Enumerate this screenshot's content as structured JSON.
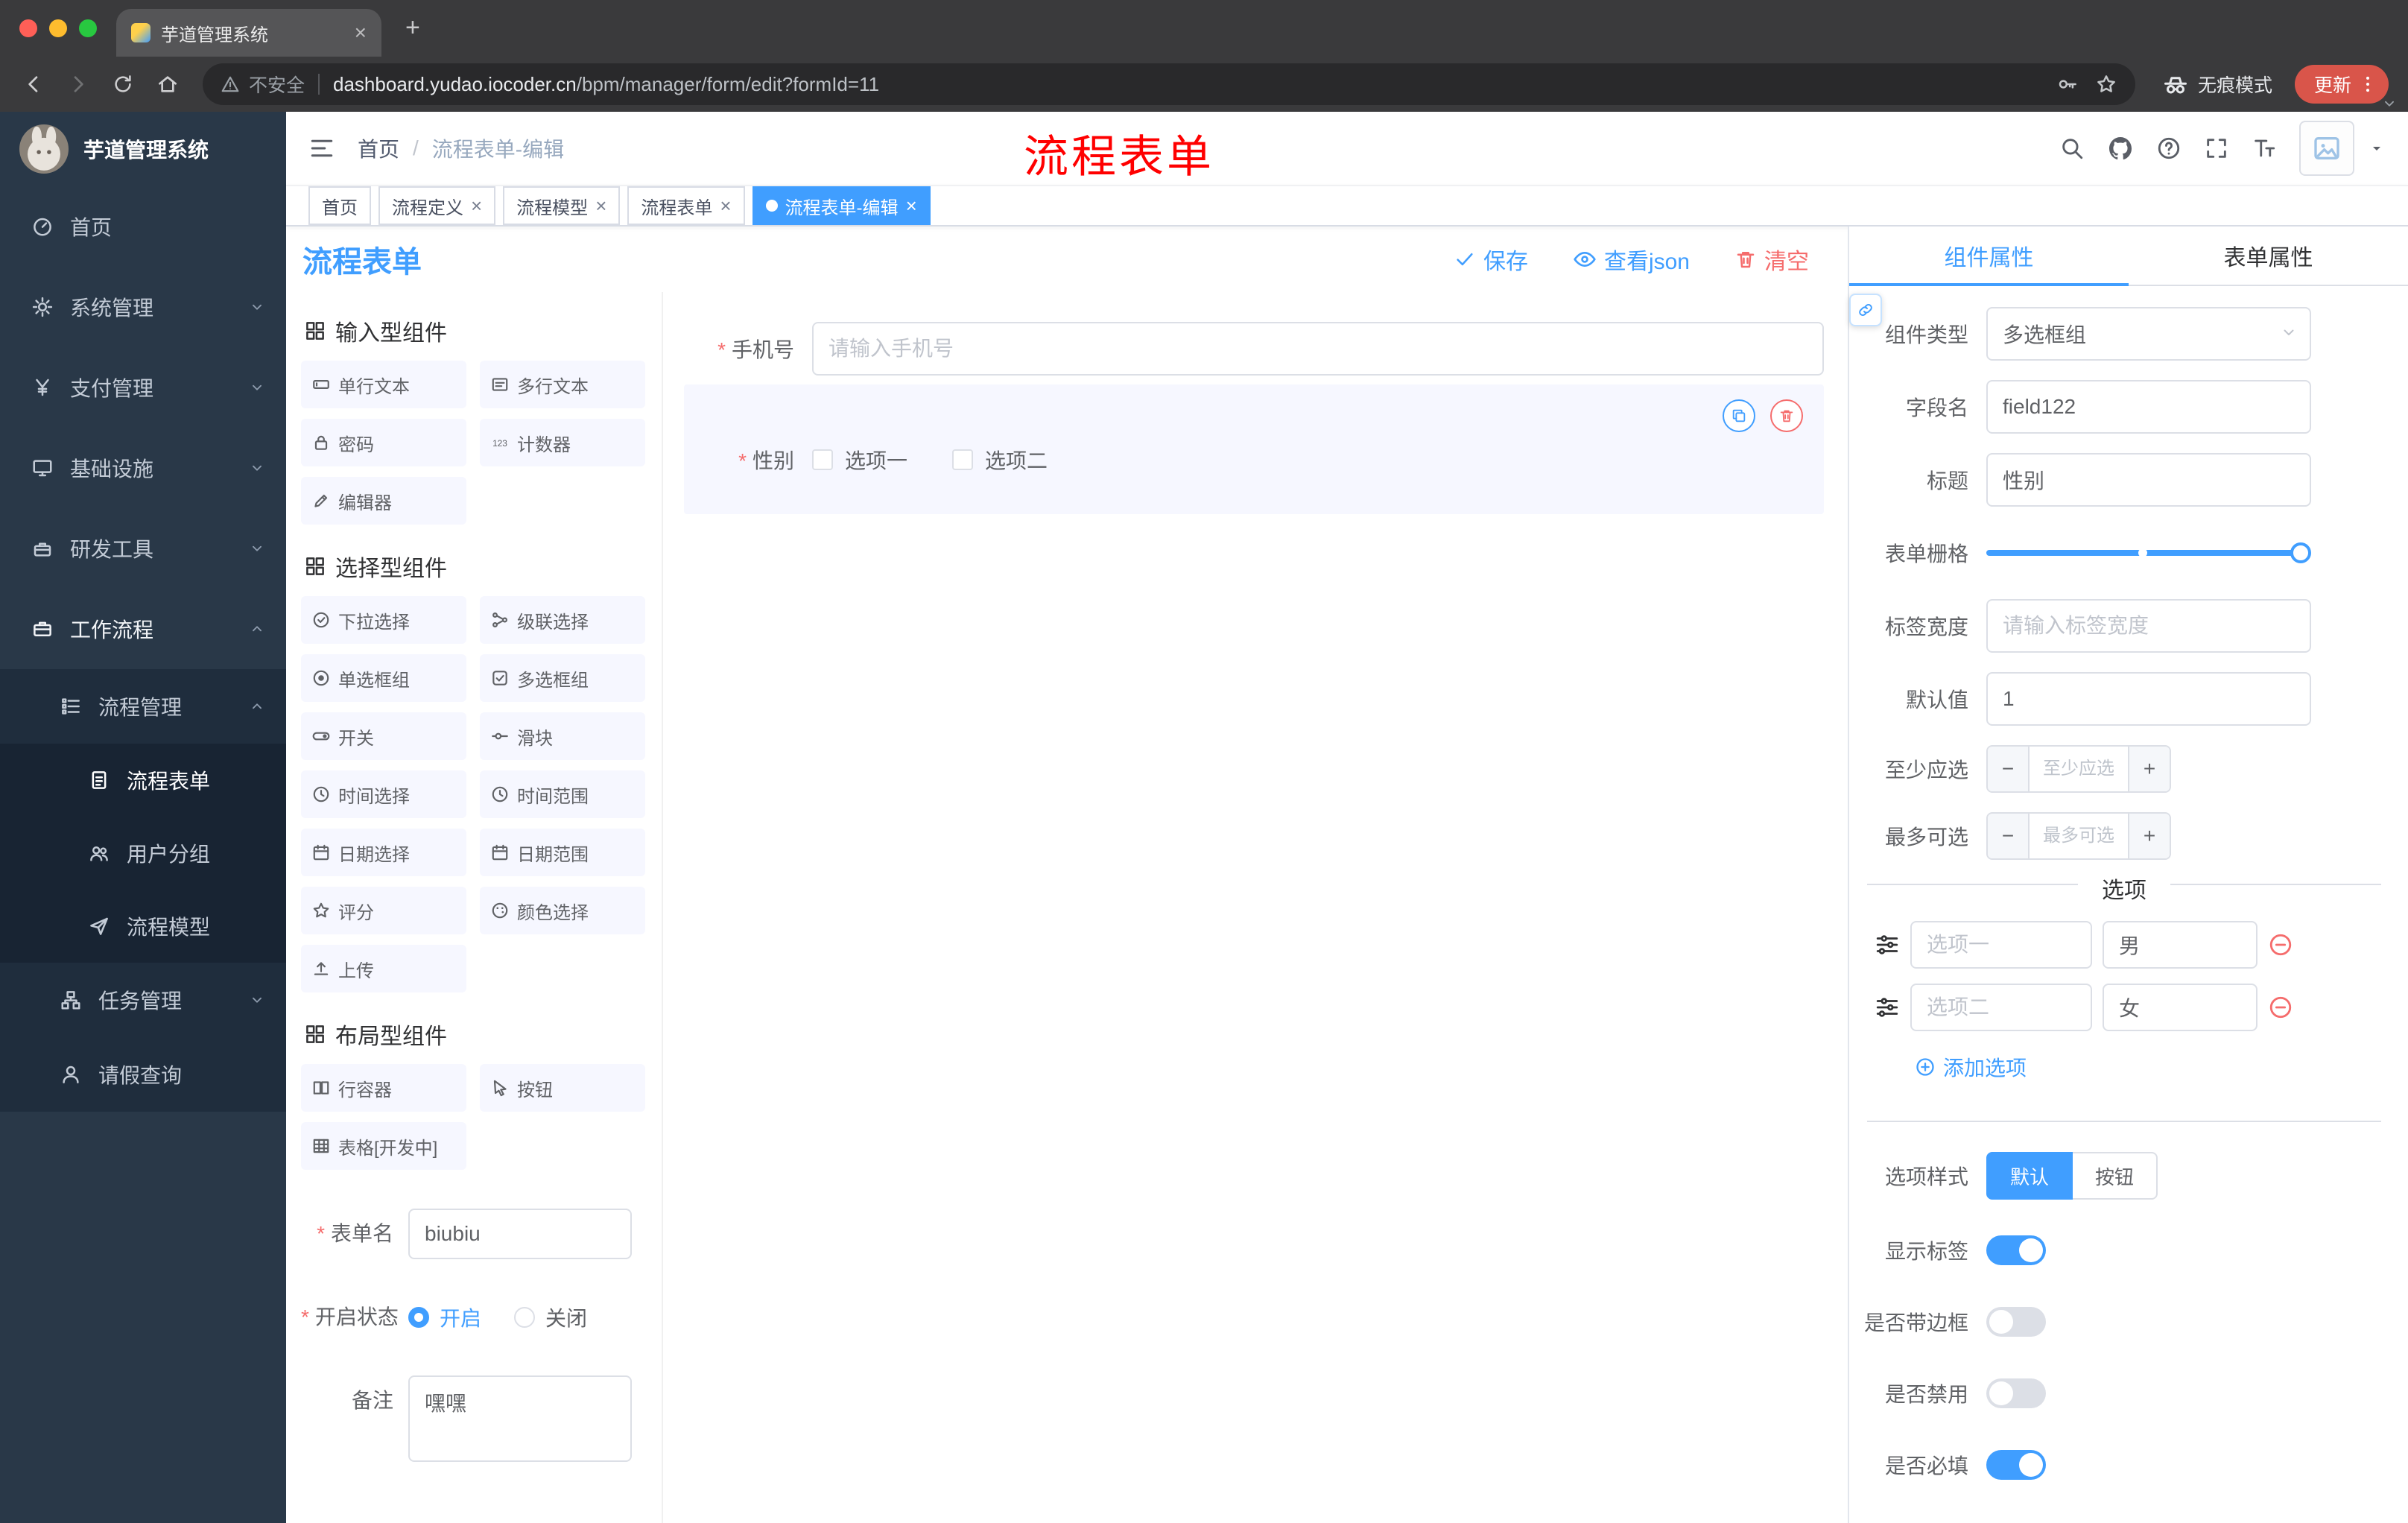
{
  "browser": {
    "tab_title": "芋道管理系统",
    "address": {
      "warning": "不安全",
      "host": "dashboard.yudao.iocoder.cn",
      "path": "/bpm/manager/form/edit?formId=11"
    },
    "incognito_label": "无痕模式",
    "update_label": "更新"
  },
  "sidebar": {
    "title": "芋道管理系统",
    "items": {
      "home": "首页",
      "system": "系统管理",
      "pay": "支付管理",
      "infra": "基础设施",
      "dev": "研发工具",
      "workflow": "工作流程",
      "process_mgmt": "流程管理",
      "process_form": "流程表单",
      "user_group": "用户分组",
      "process_model": "流程模型",
      "task_mgmt": "任务管理",
      "leave_query": "请假查询"
    }
  },
  "header": {
    "breadcrumb_home": "首页",
    "breadcrumb_current": "流程表单-编辑",
    "annotation": "流程表单"
  },
  "tags": {
    "t0": "首页",
    "t1": "流程定义",
    "t2": "流程模型",
    "t3": "流程表单",
    "t4": "流程表单-编辑"
  },
  "designer": {
    "title": "流程表单",
    "save": "保存",
    "view_json": "查看json",
    "clear": "清空",
    "group_input": "输入型组件",
    "group_select": "选择型组件",
    "group_layout": "布局型组件",
    "comp": {
      "c1": "单行文本",
      "c2": "多行文本",
      "c3": "密码",
      "c4": "计数器",
      "c5": "编辑器",
      "s1": "下拉选择",
      "s2": "级联选择",
      "s3": "单选框组",
      "s4": "多选框组",
      "s5": "开关",
      "s6": "滑块",
      "s7": "时间选择",
      "s8": "时间范围",
      "s9": "日期选择",
      "s10": "日期范围",
      "s11": "评分",
      "s12": "颜色选择",
      "s13": "上传",
      "l1": "行容器",
      "l2": "按钮",
      "l3": "表格[开发中]"
    },
    "form": {
      "name_label": "表单名",
      "name_value": "biubiu",
      "status_label": "开启状态",
      "status_on": "开启",
      "status_off": "关闭",
      "remark_label": "备注",
      "remark_value": "嘿嘿"
    },
    "canvas": {
      "phone_label": "手机号",
      "phone_placeholder": "请输入手机号",
      "gender_label": "性别",
      "opt1": "选项一",
      "opt2": "选项二"
    }
  },
  "panel": {
    "tab_component": "组件属性",
    "tab_form": "表单属性",
    "type_label": "组件类型",
    "type_value": "多选框组",
    "field_label": "字段名",
    "field_value": "field122",
    "title_label": "标题",
    "title_value": "性别",
    "grid_label": "表单栅格",
    "labelw_label": "标签宽度",
    "labelw_placeholder": "请输入标签宽度",
    "default_label": "默认值",
    "default_value": "1",
    "min_label": "至少应选",
    "min_placeholder": "至少应选",
    "max_label": "最多可选",
    "max_placeholder": "最多可选",
    "options_divider": "选项",
    "opt1_label": "选项一",
    "opt1_value": "男",
    "opt2_label": "选项二",
    "opt2_value": "女",
    "add_option": "添加选项",
    "style_label": "选项样式",
    "style_default": "默认",
    "style_button": "按钮",
    "sw_show_label": "显示标签",
    "sw_border": "是否带边框",
    "sw_disabled": "是否禁用",
    "sw_required": "是否必填"
  },
  "colors": {
    "primary": "#409EFF",
    "danger": "#F56C6C",
    "annotation": "#FF0000",
    "sidebar_bg": "#293848",
    "tag_active": "#409EFF"
  }
}
